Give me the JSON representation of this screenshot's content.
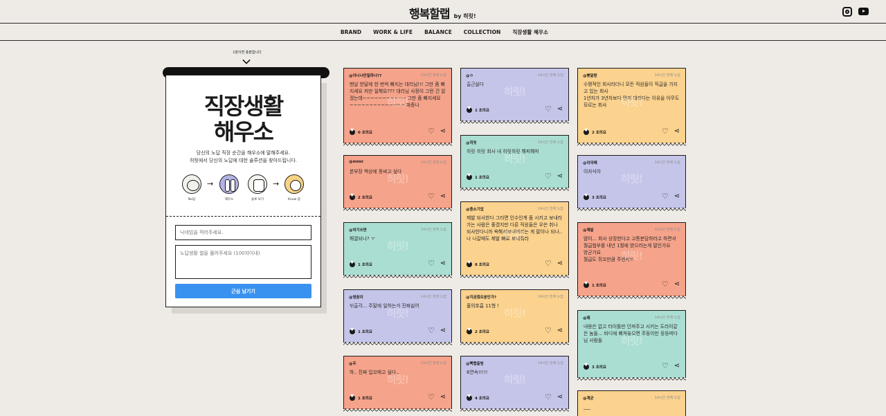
{
  "header": {
    "logo": "행복할랩",
    "logo_by": "by 히릿!",
    "social": [
      "instagram-icon",
      "youtube-icon"
    ]
  },
  "nav": [
    "BRAND",
    "WORK & LIFE",
    "BALANCE",
    "COLLECTION",
    "직장생활 해우소"
  ],
  "panel": {
    "hint": "1장이면 충분합니다",
    "title_line1": "직장생활",
    "title_line2": "해우소",
    "desc_line1": "당신의 노답 직장 순간을 해우소에 말해주세요.",
    "desc_line2": "히릿에서 당신의 노답에 대한 솔루션을 찾아드립니다.",
    "steps": [
      "No답",
      "해우소",
      "솔루 보기",
      "Know 답"
    ],
    "nickname_placeholder": "닉네임을 적어주세요.",
    "story_placeholder": "노답생활 썰을 풀어주세요 (100자이내)",
    "submit_label": "근심 남기기"
  },
  "watermark": "히릿!",
  "colors": {
    "salmon": "#f5a38a",
    "lavender": "#c5c5ea",
    "mint": "#abded3",
    "yellow": "#fbd28e",
    "button": "#3a92f0"
  },
  "cards": {
    "c0": {
      "author": "@아니나만일하나??",
      "date": "14시간 전에 노답",
      "text": "맨날 한달에 한 번씩 빠지는 대리님!!! 그만 좀 빠지세요 저만 일해요??? 대리님 사정이 그런 건 알겠는데~~~~~~~~~~~ 그만 좀 빠지세요~~~~~~~~~~~~~~ 짜증나",
      "likes": "0 초의요"
    },
    "c1": {
      "author": "@mimi",
      "date": "14시간 전에 노답",
      "text": "본부장 책상에 똥싸고 싶다",
      "likes": "2 초의요"
    },
    "c2": {
      "author": "@여기쓰면",
      "date": "14시간 전에 노답",
      "text": "해결되나? ㅜ",
      "likes": "1 초의요"
    },
    "c3": {
      "author": "@영꿈이",
      "date": "14시간 전에 노답",
      "text": "뉘출각... 주말에 일하는거 진짜싫어",
      "likes": "1 초의요"
    },
    "c4": {
      "author": "@주",
      "date": "14시간 전에 노답",
      "text": "하.. 진짜 입꼬매고 싶다..",
      "likes": "1 초의요"
    },
    "c5": {
      "author": "@ㅇ",
      "date": "14시간 전에 노답",
      "text": "출근싫다",
      "likes": "1 초의요"
    },
    "c6": {
      "author": "@히릿",
      "date": "14시간 전에 노답",
      "text": "히릿 히릿 회사 내 히릿히릿 해피해피",
      "likes": "1 초의요"
    },
    "c7": {
      "author": "@중소기업",
      "date": "14시간 전에 노답",
      "text": "제발 되사한다 그러면 인수인계 좀 시키고 보내라 가는 사람은 좋겠지만 다른 직원들은 우쓴 취나 되사한다니까 욕해서보내버리는 게 말이나 되나.. 나 나갈때도 제발 빠로 보내줘라",
      "likes": "8 초의요"
    },
    "c8": {
      "author": "@지금점오분인가?",
      "date": "14시간 전에 노답",
      "text": "풀의호흡 11형 !",
      "likes": "2 초의요"
    },
    "c9": {
      "author": "@빡랩출빙",
      "date": "14시간 전에 노답",
      "text": "8연속!!!!!",
      "likes": "4 초의요"
    },
    "c10": {
      "author": "@빵말랑",
      "date": "14시간 전에 노답",
      "text": "수평적인 회사라더니 모든 직원들이 직급을 가지고 있는 회사\n1년차가 3년차보다 먼저 대리다는 이유을 아무도 모르는 회사",
      "likes": "2 초의요"
    },
    "c11": {
      "author": "@이의떼",
      "date": "14시간 전에 노답",
      "text": "이자식아",
      "likes": "3 초의요"
    },
    "c12": {
      "author": "@제발",
      "date": "14시간 전에 노답",
      "text": "얌이... 회사 상장한다고 고통분담하라고 하면서 월급협부를 내년 1월에 받으라는게 말인가요\n방군가요\n월급도 쥐꼬만큼 주면서ㅠ",
      "likes": "1 초의요"
    },
    "c13": {
      "author": "@돼",
      "date": "14시간 전에 노답",
      "text": "내용은 없고 타이틀만 던져주고 시키는 도라이같은 놈들... 바디에 뻐쳐놓으면 주둥이만 등등떠다님 사람들",
      "likes": "3 초의요"
    },
    "c14": {
      "author": "@계균",
      "date": "14시간 전에 노답",
      "text": "___",
      "likes": ""
    }
  }
}
